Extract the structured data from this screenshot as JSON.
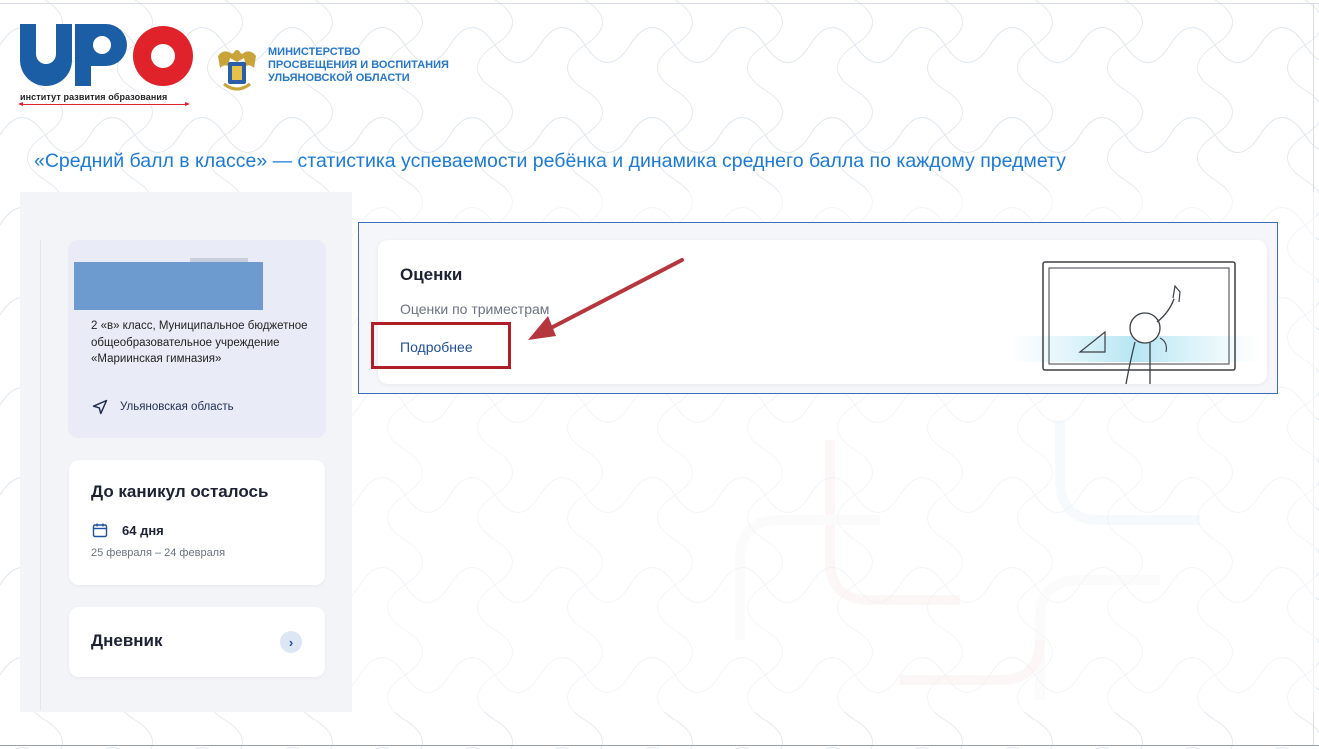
{
  "logo": {
    "caption": "институт развития образования",
    "letters": "ИРО"
  },
  "ministry": {
    "line1": "МИНИСТЕРСТВО",
    "line2": "ПРОСВЕЩЕНИЯ И ВОСПИТАНИЯ",
    "line3": "УЛЬЯНОВСКОЙ ОБЛАСТИ"
  },
  "headline": "«Средний балл в классе» — статистика успеваемости ребёнка и динамика среднего балла по каждому предмету",
  "student": {
    "school": "2 «в» класс, Муниципальное бюджетное общеобразовательное учреждение «Мариинская гимназия»",
    "region": "Ульяновская область"
  },
  "vacation": {
    "title": "До каникул осталось",
    "days": "64 дня",
    "dates": "25 февраля – 24 февраля"
  },
  "diary": {
    "title": "Дневник"
  },
  "grades": {
    "title": "Оценки",
    "subtitle": "Оценки по триместрам",
    "more": "Подробнее"
  },
  "colors": {
    "brand_blue": "#1c5ea6",
    "brand_red": "#e0222b",
    "headline_blue": "#1a7ad6",
    "highlight_red": "#b01e28",
    "card_outline": "#3a6fb8"
  },
  "icons": {
    "region": "navigation-arrow-icon",
    "days": "calendar-icon",
    "diary": "chevron-right-icon"
  }
}
